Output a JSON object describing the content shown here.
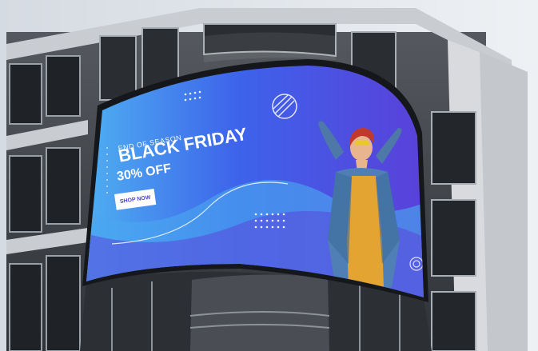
{
  "billboard": {
    "eyebrow": "END OF SEASON",
    "headline": "BLACK FRIDAY",
    "discount": "30% OFF",
    "cta": "SHOP NOW"
  },
  "colors": {
    "screen_blue": "#3f56e6",
    "screen_light": "#4fb2f2",
    "screen_purple": "#5b3fd9",
    "building_dark": "#3a3d42",
    "building_light": "#c9ccd1",
    "sky": "#dde3ea"
  }
}
